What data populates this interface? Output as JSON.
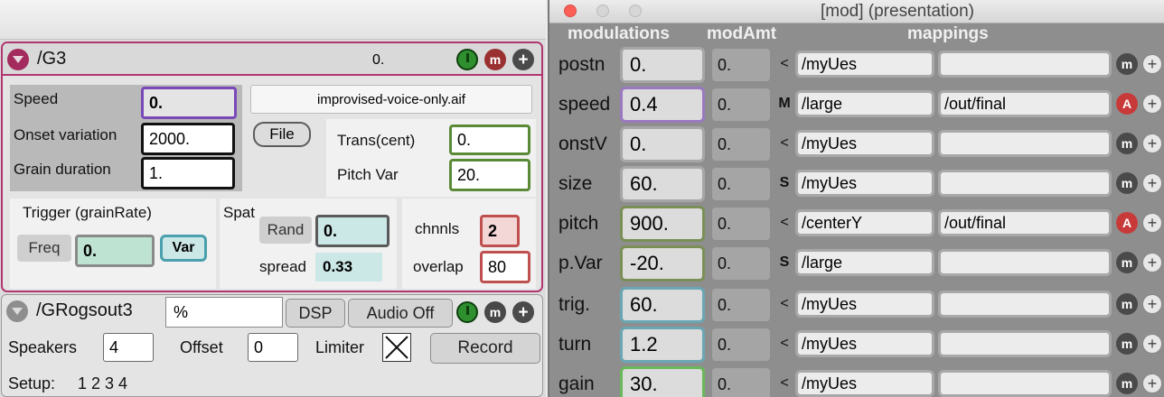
{
  "left": {
    "g3": {
      "title": "/G3",
      "value": "0.",
      "m_label": "m",
      "plus_label": "+",
      "speed_label": "Speed",
      "speed_value": "0.",
      "onset_label": "Onset variation",
      "onset_value": "2000.",
      "grain_label": "Grain duration",
      "grain_value": "1.",
      "filename": "improvised-voice-only.aif",
      "file_button": "File",
      "trans_label": "Trans(cent)",
      "trans_value": "0.",
      "pitchvar_label": "Pitch Var",
      "pitchvar_value": "20.",
      "trigger_label": "Trigger (grainRate)",
      "freq_label": "Freq",
      "freq_value": "0.",
      "var_button": "Var",
      "spat_label": "Spat",
      "rand_button": "Rand",
      "rand_value": "0.",
      "spread_label": "spread",
      "spread_value": "0.33",
      "chnnls_label": "chnnls",
      "chnnls_value": "2",
      "overlap_label": "overlap",
      "overlap_value": "80"
    },
    "gro": {
      "title": "/GRogsout3",
      "field_value": "%",
      "dsp_button": "DSP",
      "audio_button": "Audio Off",
      "m_label": "m",
      "plus_label": "+",
      "speakers_label": "Speakers",
      "speakers_value": "4",
      "offset_label": "Offset",
      "offset_value": "0",
      "limiter_label": "Limiter",
      "record_button": "Record",
      "setup_label": "Setup:",
      "setup_values": "1 2 3 4"
    }
  },
  "right": {
    "window_title": "[mod] (presentation)",
    "headers": {
      "modulations": "modulations",
      "modAmt": "modAmt",
      "mappings": "mappings"
    },
    "rows": [
      {
        "label": "postn",
        "value": "0.",
        "amt": "0.",
        "sym": "<",
        "map_in": "/myUes",
        "map_out": "",
        "m": "m",
        "plus": "+"
      },
      {
        "label": "speed",
        "value": "0.4",
        "amt": "0.",
        "sym": "M",
        "map_in": "/large",
        "map_out": "/out/final",
        "m": "A",
        "plus": "+"
      },
      {
        "label": "onstV",
        "value": "0.",
        "amt": "0.",
        "sym": "<",
        "map_in": "/myUes",
        "map_out": "",
        "m": "m",
        "plus": "+"
      },
      {
        "label": "size",
        "value": "60.",
        "amt": "0.",
        "sym": "S",
        "map_in": "/myUes",
        "map_out": "",
        "m": "m",
        "plus": "+"
      },
      {
        "label": "pitch",
        "value": "900.",
        "amt": "0.",
        "sym": "<",
        "map_in": "/centerY",
        "map_out": "/out/final",
        "m": "A",
        "plus": "+"
      },
      {
        "label": "p.Var",
        "value": "-20.",
        "amt": "0.",
        "sym": "S",
        "map_in": "/large",
        "map_out": "",
        "m": "m",
        "plus": "+"
      },
      {
        "label": "trig.",
        "value": "60.",
        "amt": "0.",
        "sym": "<",
        "map_in": "/myUes",
        "map_out": "",
        "m": "m",
        "plus": "+"
      },
      {
        "label": "turn",
        "value": "1.2",
        "amt": "0.",
        "sym": "<",
        "map_in": "/myUes",
        "map_out": "",
        "m": "m",
        "plus": "+"
      },
      {
        "label": "gain",
        "value": "30.",
        "amt": "0.",
        "sym": "<",
        "map_in": "/myUes",
        "map_out": "",
        "m": "m",
        "plus": "+"
      }
    ],
    "row_border_colors": [
      "#a6a6a6",
      "#9a79c0",
      "#a6a6a6",
      "#a6a6a6",
      "#7a8f55",
      "#7a8f55",
      "#6aa6b3",
      "#6aa6b3",
      "#69b85a"
    ],
    "active_color": "#c83a3a"
  }
}
